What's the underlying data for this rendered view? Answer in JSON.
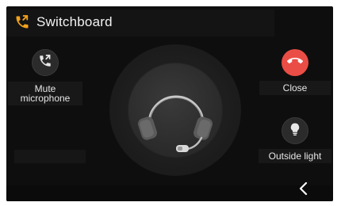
{
  "header": {
    "title": "Switchboard",
    "icon": "phone-forward-icon"
  },
  "buttons": {
    "mute": {
      "label": "Mute microphone",
      "icon": "phone-forward-icon"
    },
    "close": {
      "label": "Close",
      "icon": "hang-up-icon"
    },
    "light": {
      "label": "Outside light",
      "icon": "light-bulb-icon"
    }
  },
  "center": {
    "icon": "headset-icon"
  },
  "nav": {
    "back_icon": "chevron-left-icon"
  },
  "colors": {
    "accent": "#f3a21b",
    "close_red": "#ea4d45",
    "background": "#0e0e0e"
  }
}
